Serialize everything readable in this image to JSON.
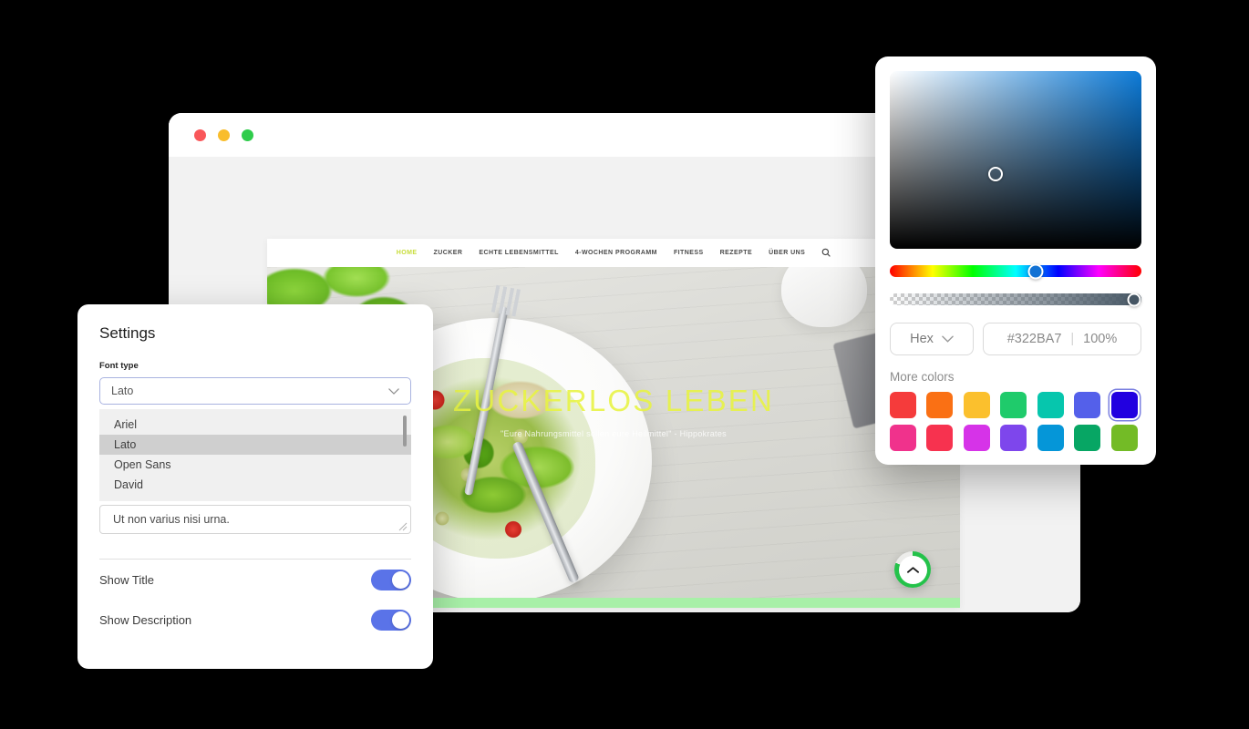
{
  "browser": {
    "traffic_lights": [
      {
        "name": "close",
        "color": "#f9575a"
      },
      {
        "name": "minimize",
        "color": "#f9bd2c"
      },
      {
        "name": "maximize",
        "color": "#2fcc4b"
      }
    ]
  },
  "website": {
    "nav": [
      {
        "label": "HOME",
        "active": true
      },
      {
        "label": "ZUCKER",
        "active": false
      },
      {
        "label": "ECHTE LEBENSMITTEL",
        "active": false
      },
      {
        "label": "4-WOCHEN PROGRAMM",
        "active": false
      },
      {
        "label": "FITNESS",
        "active": false
      },
      {
        "label": "REZEPTE",
        "active": false
      },
      {
        "label": "ÜBER UNS",
        "active": false
      }
    ],
    "search_icon": "search-icon",
    "hero": {
      "title": "ZUCKERLOS LEBEN",
      "subtitle": "\"Eure Nahrungsmittel sollen eure Heilmittel\" - Hippokrates",
      "title_color": "#e8f442"
    },
    "scroll_top": {
      "icon": "chevron-up-icon",
      "ring_color": "#24c24a",
      "progress_percent": 81
    },
    "progress": {
      "percent": 9,
      "track_color": "#a8f0a8",
      "fill_color": "#2ed04a"
    }
  },
  "settings": {
    "title": "Settings",
    "font_field": {
      "label": "Font type",
      "value": "Lato",
      "chevron_icon": "chevron-down-icon",
      "options": [
        {
          "label": "Ariel",
          "selected": false
        },
        {
          "label": "Lato",
          "selected": true
        },
        {
          "label": "Open Sans",
          "selected": false
        },
        {
          "label": "David",
          "selected": false
        }
      ]
    },
    "textarea": {
      "value": "Ut non varius nisi urna.",
      "placeholder": "Ut non varius nisi urna.",
      "resize_icon": "resize-grip-icon"
    },
    "toggles": [
      {
        "label": "Show Title",
        "on": true
      },
      {
        "label": "Show Description",
        "on": true
      }
    ],
    "toggle_on_color": "#5a73e8"
  },
  "color_picker": {
    "sv_cursor": {
      "x_percent": 42,
      "y_percent": 58
    },
    "hue_handle_percent": 58,
    "alpha_handle_percent": 97,
    "mode": {
      "label": "Hex",
      "chevron_icon": "chevron-down-icon"
    },
    "hex_value": "#322BA7",
    "opacity_value": "100%",
    "separator": "|",
    "more_colors_label": "More colors",
    "swatches": [
      {
        "color": "#f53b3b",
        "selected": false
      },
      {
        "color": "#fa7014",
        "selected": false
      },
      {
        "color": "#fbc02d",
        "selected": false
      },
      {
        "color": "#1fcb6b",
        "selected": false
      },
      {
        "color": "#06c6ad",
        "selected": false
      },
      {
        "color": "#5460ea",
        "selected": false
      },
      {
        "color": "#2200e0",
        "selected": true
      },
      {
        "color": "#f0328c",
        "selected": false
      },
      {
        "color": "#f7324f",
        "selected": false
      },
      {
        "color": "#d633e8",
        "selected": false
      },
      {
        "color": "#7e46ec",
        "selected": false
      },
      {
        "color": "#0596d8",
        "selected": false
      },
      {
        "color": "#07a664",
        "selected": false
      },
      {
        "color": "#73bb26",
        "selected": false
      }
    ]
  }
}
